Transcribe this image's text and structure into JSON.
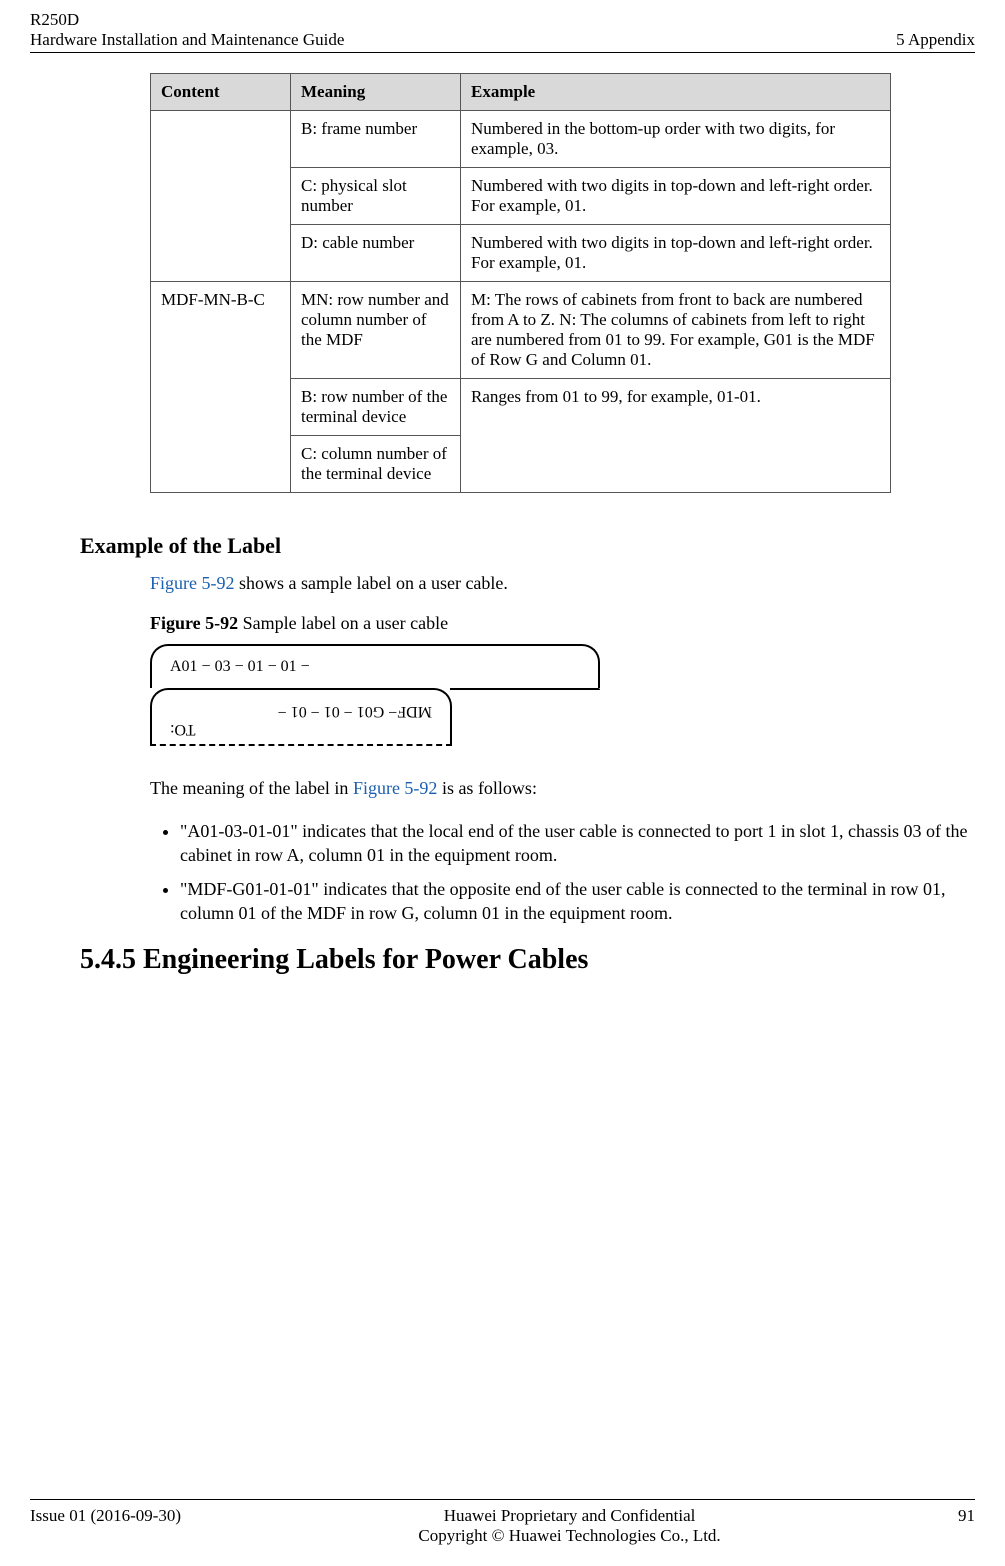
{
  "header": {
    "left_line1": "R250D",
    "left_line2": "Hardware Installation and Maintenance Guide",
    "right": "5 Appendix"
  },
  "table": {
    "headers": [
      "Content",
      "Meaning",
      "Example"
    ],
    "r1": {
      "meaning": "B: frame number",
      "example": "Numbered in the bottom-up order with two digits, for example, 03."
    },
    "r2": {
      "meaning": "C: physical slot number",
      "example": "Numbered with two digits in top-down and left-right order. For example, 01."
    },
    "r3": {
      "meaning": "D: cable number",
      "example": "Numbered with two digits in top-down and left-right order. For example, 01."
    },
    "r4": {
      "content": "MDF-MN-B-C",
      "meaning": "MN: row number and column number of the MDF",
      "example": "M: The rows of cabinets from front to back are numbered from A to Z. N: The columns of cabinets from left to right are numbered from 01 to 99. For example, G01 is the MDF of Row G and Column 01."
    },
    "r5": {
      "meaning": "B: row number of the terminal device",
      "example": "Ranges from 01 to 99, for example, 01-01."
    },
    "r6": {
      "meaning": "C: column number of the terminal device"
    }
  },
  "section_heading": "Example of the Label",
  "intro_para_pre": "",
  "figure_link_text": "Figure 5-92",
  "intro_para_post": " shows a sample label on a user cable.",
  "figure_caption_strong": "Figure 5-92",
  "figure_caption_text": " Sample label on a user cable",
  "label_top_text": "A01 − 03  − 01 − 01 −",
  "label_bottom_to": "TO:",
  "label_bottom_text": "MDF− G01 − 01 − 01  −",
  "meaning_para_pre": "The meaning of the label in ",
  "meaning_para_post": " is as follows:",
  "bullets": [
    "\"A01-03-01-01\" indicates that the local end of the user cable is connected to port 1 in slot 1, chassis 03 of the cabinet in row A, column 01 in the equipment room.",
    "\"MDF-G01-01-01\" indicates that the opposite end of the user cable is connected to the terminal in row 01, column 01 of the MDF in row G, column 01 in the equipment room."
  ],
  "big_heading": "5.4.5 Engineering Labels for Power Cables",
  "footer": {
    "left": "Issue 01 (2016-09-30)",
    "center_line1": "Huawei Proprietary and Confidential",
    "center_line2": "Copyright © Huawei Technologies Co., Ltd.",
    "right": "91"
  }
}
